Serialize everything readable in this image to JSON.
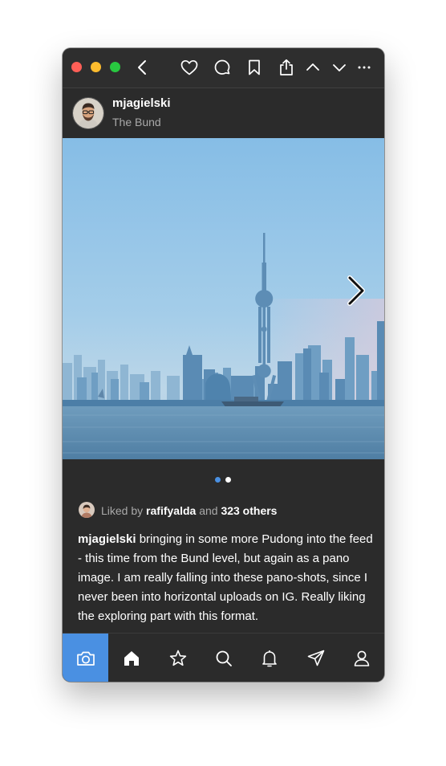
{
  "post": {
    "username": "mjagielski",
    "location": "The Bund"
  },
  "carousel": {
    "dot_count": 2,
    "active_index": 0
  },
  "likes": {
    "prefix": "Liked by",
    "user": "rafifyalda",
    "connector": "and",
    "others": "323 others"
  },
  "caption": {
    "author": "mjagielski",
    "text": "bringing in some more Pudong into the feed - this time from the Bund level, but again as a pano image. I am really falling into these pano-shots, since I never been into horizontal uploads on IG. Really liking the exploring part with this format."
  },
  "toolbar_icons": [
    "back-chevron-icon",
    "heart-icon",
    "comment-icon",
    "bookmark-icon",
    "share-icon",
    "chevron-up-icon",
    "chevron-down-icon",
    "more-icon"
  ],
  "tabs": [
    {
      "icon": "camera-icon",
      "active": true
    },
    {
      "icon": "home-icon",
      "active": false
    },
    {
      "icon": "star-icon",
      "active": false
    },
    {
      "icon": "search-icon",
      "active": false
    },
    {
      "icon": "bell-icon",
      "active": false
    },
    {
      "icon": "send-icon",
      "active": false
    },
    {
      "icon": "profile-icon",
      "active": false
    }
  ],
  "colors": {
    "accent": "#4a90e2",
    "window_bg": "#2b2b2b",
    "text_secondary": "#a9a9a9"
  }
}
